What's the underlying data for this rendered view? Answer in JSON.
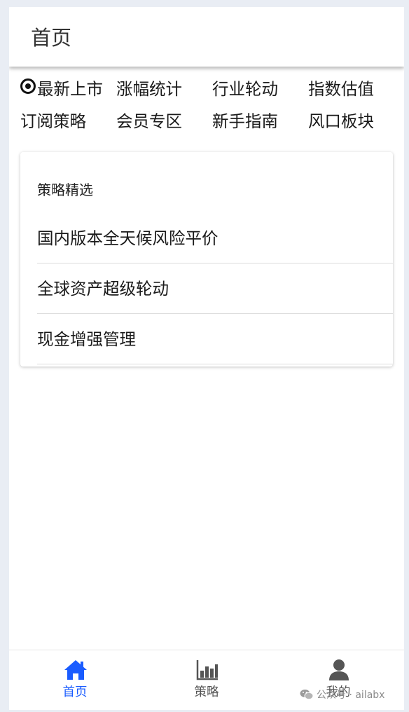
{
  "header": {
    "title": "首页"
  },
  "nav": {
    "items": [
      {
        "label": "最新上市",
        "icon": "radio-selected-icon"
      },
      {
        "label": "涨幅统计"
      },
      {
        "label": "行业轮动"
      },
      {
        "label": "指数估值"
      },
      {
        "label": "订阅策略"
      },
      {
        "label": "会员专区"
      },
      {
        "label": "新手指南"
      },
      {
        "label": "风口板块"
      }
    ]
  },
  "strategy_card": {
    "title": "策略精选",
    "items": [
      {
        "label": "国内版本全天候风险平价"
      },
      {
        "label": "全球资产超级轮动"
      },
      {
        "label": "现金增强管理"
      }
    ]
  },
  "tabbar": {
    "active_color": "#1a5cff",
    "inactive_color": "#555555",
    "tabs": [
      {
        "label": "首页",
        "icon": "home-icon",
        "active": true
      },
      {
        "label": "策略",
        "icon": "bar-chart-icon",
        "active": false
      },
      {
        "label": "我的",
        "icon": "user-icon",
        "active": false
      }
    ]
  },
  "watermark": {
    "text": "公众号 · ailabx",
    "icon": "wechat-icon"
  }
}
